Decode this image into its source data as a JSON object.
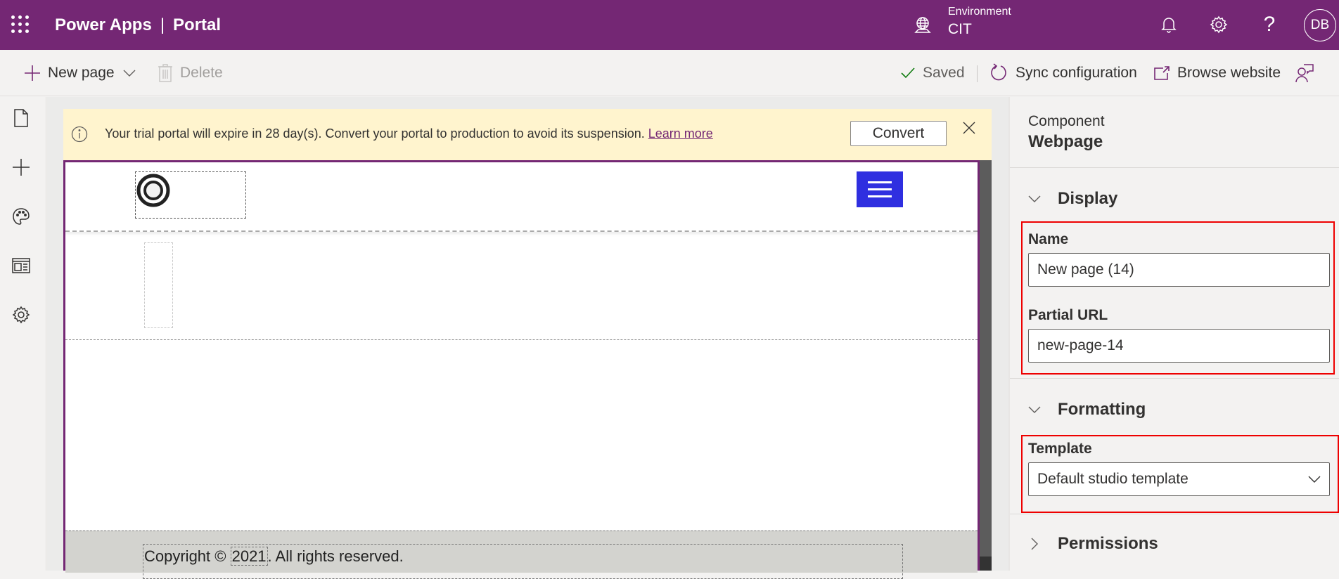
{
  "topbar": {
    "app_name": "Power Apps",
    "separator": "|",
    "section": "Portal",
    "environment_label": "Environment",
    "environment_value": "CIT",
    "avatar_initials": "DB",
    "help_glyph": "?",
    "icons": [
      "waffle-icon",
      "globe-icon",
      "bell-icon",
      "gear-icon",
      "help-icon"
    ],
    "brand_color": "#742774"
  },
  "commandbar": {
    "new_page": "New page",
    "delete": "Delete",
    "saved": "Saved",
    "sync": "Sync configuration",
    "browse": "Browse website"
  },
  "leftrail": {
    "items": [
      "pages-icon",
      "add-components-icon",
      "themes-icon",
      "templates-icon",
      "settings-icon"
    ]
  },
  "banner": {
    "message": "Your trial portal will expire in 28 day(s). Convert your portal to production to avoid its suspension.",
    "link": "Learn more",
    "button": "Convert"
  },
  "preview": {
    "footer_prefix": "Copyright © ",
    "footer_year": "2021",
    "footer_suffix": ". All rights reserved.",
    "nav_button_color": "#2f2fe0"
  },
  "panel": {
    "component_label": "Component",
    "component_value": "Webpage",
    "sections": {
      "display": "Display",
      "formatting": "Formatting",
      "permissions": "Permissions"
    },
    "fields": {
      "name_label": "Name",
      "name_value": "New page (14)",
      "url_label": "Partial URL",
      "url_value": "new-page-14",
      "template_label": "Template",
      "template_value": "Default studio template"
    }
  }
}
